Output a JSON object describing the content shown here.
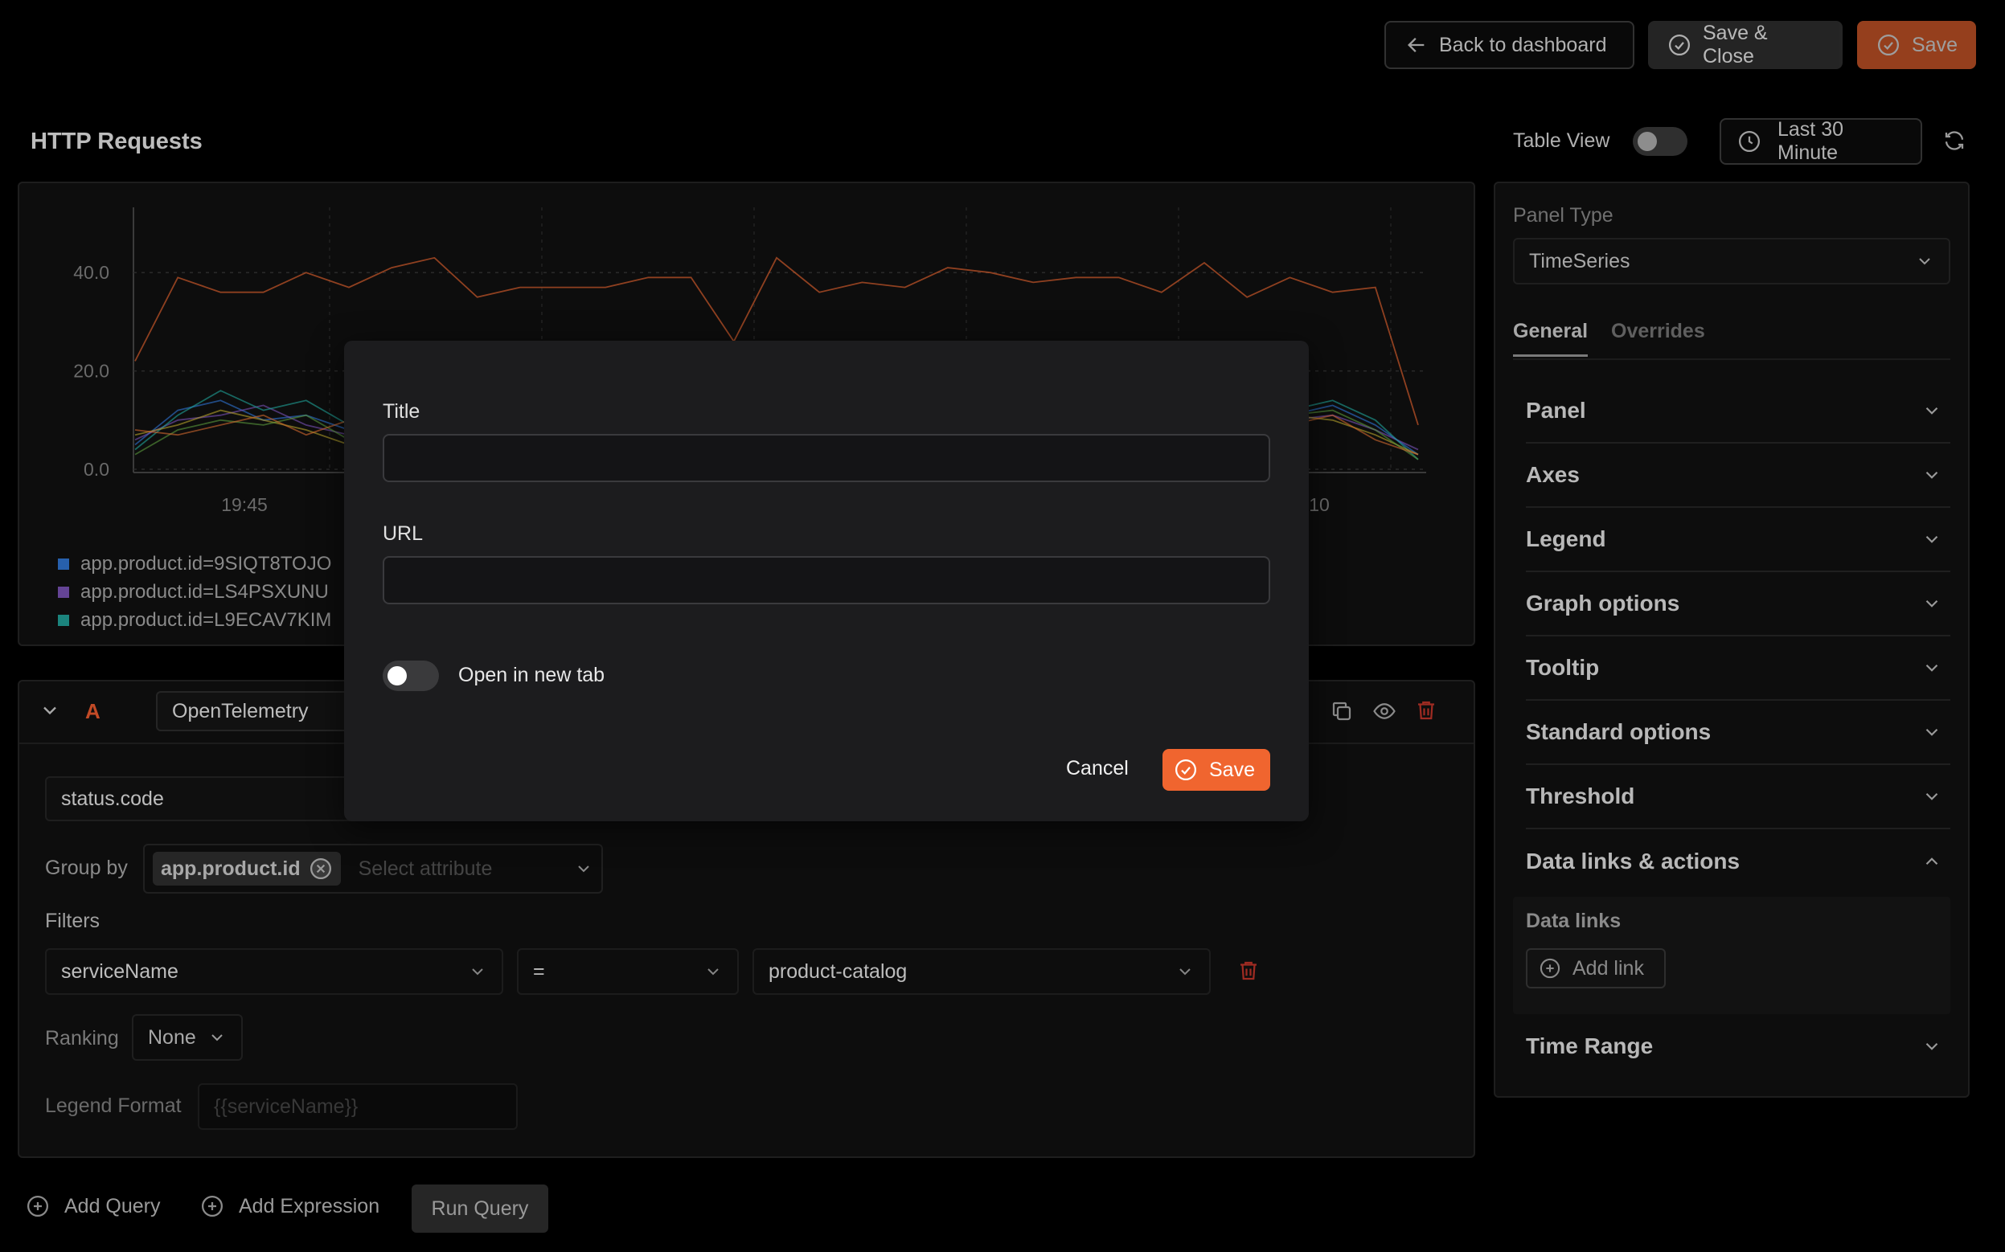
{
  "header": {
    "back_label": "Back to dashboard",
    "save_close_label": "Save & Close",
    "save_label": "Save"
  },
  "panel_title": "HTTP Requests",
  "table_view_label": "Table View",
  "time_range_label": "Last 30 Minute",
  "chart_data": {
    "type": "line",
    "y_ticks": [
      "40.0",
      "20.0",
      "0.0"
    ],
    "x_ticks": [
      "19:45",
      "10"
    ],
    "ylim": [
      0,
      50
    ],
    "series": [
      {
        "color": "#c8572a",
        "values": [
          22,
          39,
          36,
          36,
          40,
          37,
          41,
          43,
          35,
          37,
          37,
          37,
          39,
          39,
          26,
          43,
          36,
          38,
          37,
          41,
          40,
          38,
          39,
          39,
          36,
          42,
          35,
          39,
          36,
          37,
          9
        ]
      },
      {
        "color": "#2e75d6",
        "values": [
          5,
          12,
          14,
          10,
          11,
          8,
          14,
          10,
          12,
          11,
          9,
          10,
          12,
          11,
          9,
          10,
          11,
          12,
          10,
          13,
          11,
          10,
          12,
          11,
          9,
          12,
          10,
          11,
          13,
          9,
          3
        ]
      },
      {
        "color": "#7a52b8",
        "values": [
          6,
          10,
          11,
          13,
          9,
          7,
          12,
          11,
          10,
          9,
          12,
          11,
          10,
          12,
          10,
          11,
          9,
          10,
          12,
          11,
          10,
          9,
          11,
          12,
          10,
          11,
          12,
          10,
          11,
          8,
          4
        ]
      },
      {
        "color": "#1fa39a",
        "values": [
          4,
          11,
          16,
          12,
          14,
          9,
          10,
          13,
          11,
          10,
          11,
          12,
          9,
          10,
          12,
          11,
          10,
          12,
          11,
          10,
          12,
          13,
          10,
          11,
          12,
          10,
          11,
          12,
          14,
          10,
          2
        ]
      },
      {
        "color": "#b5a22c",
        "values": [
          7,
          9,
          12,
          10,
          8,
          5,
          11,
          12,
          9,
          10,
          10,
          9,
          11,
          12,
          10,
          9,
          11,
          10,
          12,
          9,
          11,
          10,
          9,
          12,
          11,
          10,
          9,
          11,
          10,
          7,
          3
        ]
      },
      {
        "color": "#5a9a3c",
        "values": [
          3,
          8,
          10,
          9,
          11,
          6,
          9,
          8,
          10,
          12,
          9,
          10,
          11,
          9,
          10,
          12,
          10,
          9,
          11,
          10,
          9,
          11,
          12,
          10,
          11,
          9,
          10,
          11,
          12,
          8,
          2
        ]
      },
      {
        "color": "#d2692e",
        "values": [
          8,
          7,
          9,
          11,
          7,
          10,
          15,
          9,
          8,
          11,
          10,
          12,
          10,
          9,
          11,
          10,
          12,
          11,
          9,
          12,
          10,
          11,
          10,
          9,
          12,
          11,
          10,
          9,
          11,
          6,
          3
        ]
      }
    ]
  },
  "legend": [
    {
      "label": "app.product.id=9SIQT8TOJO",
      "color": "#2e75d6"
    },
    {
      "label": "app.product.id=LS4PSXUNU",
      "color": "#7a52b8"
    },
    {
      "label": "app.product.id=L9ECAV7KIM",
      "color": "#1fa39a"
    }
  ],
  "query": {
    "letter": "A",
    "source": "OpenTelemetry",
    "metric": "status.code",
    "group_by_label": "Group by",
    "group_by_tag": "app.product.id",
    "select_attribute_placeholder": "Select attribute",
    "filters_label": "Filters",
    "filter_key": "serviceName",
    "filter_op": "=",
    "filter_value": "product-catalog",
    "ranking_label": "Ranking",
    "ranking_value": "None",
    "legend_format_label": "Legend Format",
    "legend_format_placeholder": "{{serviceName}}"
  },
  "footer": {
    "add_query": "Add Query",
    "add_expression": "Add Expression",
    "run_query": "Run Query"
  },
  "sidebar": {
    "panel_type_label": "Panel Type",
    "panel_type_value": "TimeSeries",
    "tabs": [
      "General",
      "Overrides"
    ],
    "sections": [
      "Panel",
      "Axes",
      "Legend",
      "Graph options",
      "Tooltip",
      "Standard options",
      "Threshold",
      "Data links & actions"
    ],
    "data_links_label": "Data links",
    "add_link_label": "Add link",
    "time_range_section": "Time Range"
  },
  "modal": {
    "title_label": "Title",
    "url_label": "URL",
    "toggle_label": "Open in new tab",
    "cancel_label": "Cancel",
    "save_label": "Save"
  }
}
